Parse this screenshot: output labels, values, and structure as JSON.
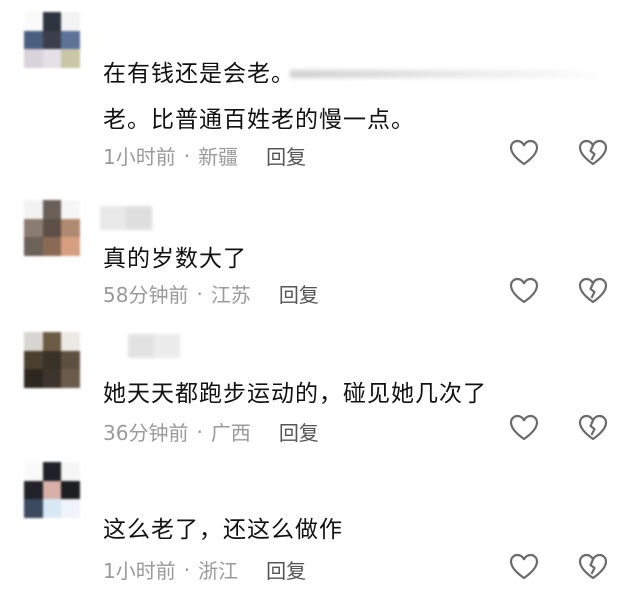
{
  "comments": [
    {
      "lines": [
        "在有钱还是会老。",
        "老。比普通百姓老的慢一点。"
      ],
      "time": "1小时前",
      "location": "新疆",
      "reply_label": "回复",
      "like_icon": "heart-outline-icon",
      "dislike_icon": "broken-heart-icon"
    },
    {
      "lines": [
        "真的岁数大了"
      ],
      "time": "58分钟前",
      "location": "江苏",
      "reply_label": "回复",
      "like_icon": "heart-outline-icon",
      "dislike_icon": "broken-heart-icon"
    },
    {
      "lines": [
        "她天天都跑步运动的，碰见她几次了"
      ],
      "time": "36分钟前",
      "location": "广西",
      "reply_label": "回复",
      "like_icon": "heart-outline-icon",
      "dislike_icon": "broken-heart-icon"
    },
    {
      "lines": [
        "这么老了，还这么做作"
      ],
      "time": "1小时前",
      "location": "浙江",
      "reply_label": "回复",
      "like_icon": "heart-outline-icon",
      "dislike_icon": "broken-heart-icon"
    }
  ],
  "separator": "·",
  "colors": {
    "text": "#111111",
    "meta": "#9a9a9a",
    "reply": "#555555",
    "icon": "#6b6b6b"
  }
}
